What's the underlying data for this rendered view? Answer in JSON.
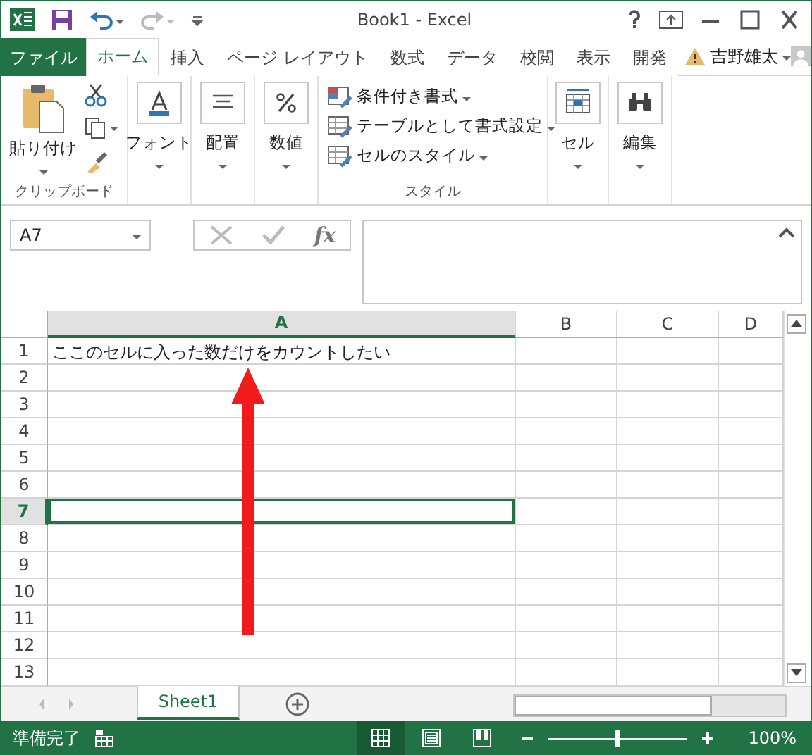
{
  "window": {
    "title": "Book1 - Excel"
  },
  "tabs": [
    {
      "label": "ファイル",
      "kind": "file",
      "selected": false
    },
    {
      "label": "ホーム",
      "kind": "tab",
      "selected": true
    },
    {
      "label": "挿入",
      "kind": "tab",
      "selected": false
    },
    {
      "label": "ページ レイアウト",
      "kind": "tab",
      "selected": false
    },
    {
      "label": "数式",
      "kind": "tab",
      "selected": false
    },
    {
      "label": "データ",
      "kind": "tab",
      "selected": false
    },
    {
      "label": "校閲",
      "kind": "tab",
      "selected": false
    },
    {
      "label": "表示",
      "kind": "tab",
      "selected": false
    },
    {
      "label": "開発",
      "kind": "tab",
      "selected": false
    }
  ],
  "user": {
    "name": "吉野雄太"
  },
  "ribbon": [
    {
      "kind": "clipboard",
      "button": "貼り付け",
      "label": "クリップボード"
    },
    {
      "kind": "single",
      "button": "フォント"
    },
    {
      "kind": "single",
      "button": "配置"
    },
    {
      "kind": "single",
      "button": "数値"
    },
    {
      "kind": "list",
      "label": "スタイル",
      "items": [
        "条件付き書式",
        "テーブルとして書式設定",
        "セルのスタイル"
      ]
    },
    {
      "kind": "single",
      "button": "セル"
    },
    {
      "kind": "single",
      "button": "編集"
    }
  ],
  "name_box": {
    "value": "A7"
  },
  "formula_bar": {
    "fx": "fx"
  },
  "columns": [
    {
      "label": "A",
      "selected": true
    },
    {
      "label": "B",
      "selected": false
    },
    {
      "label": "C",
      "selected": false
    },
    {
      "label": "D",
      "selected": false
    }
  ],
  "rows": [
    {
      "number": "1",
      "selected": false,
      "cell_a": "ここのセルに入った数だけをカウントしたい"
    },
    {
      "number": "2",
      "selected": false
    },
    {
      "number": "3",
      "selected": false
    },
    {
      "number": "4",
      "selected": false
    },
    {
      "number": "5",
      "selected": false
    },
    {
      "number": "6",
      "selected": false
    },
    {
      "number": "7",
      "selected": true
    },
    {
      "number": "8",
      "selected": false
    },
    {
      "number": "9",
      "selected": false
    },
    {
      "number": "10",
      "selected": false
    },
    {
      "number": "11",
      "selected": false
    },
    {
      "number": "12",
      "selected": false
    },
    {
      "number": "13",
      "selected": false
    }
  ],
  "sheets": [
    {
      "label": "Sheet1",
      "selected": true
    }
  ],
  "status_bar": {
    "text": "準備完了",
    "views": [
      {
        "kind": "normal",
        "selected": true
      },
      {
        "kind": "layout",
        "selected": false
      },
      {
        "kind": "break",
        "selected": false
      }
    ],
    "zoom": {
      "level": 0.5,
      "reading": "100%"
    }
  }
}
